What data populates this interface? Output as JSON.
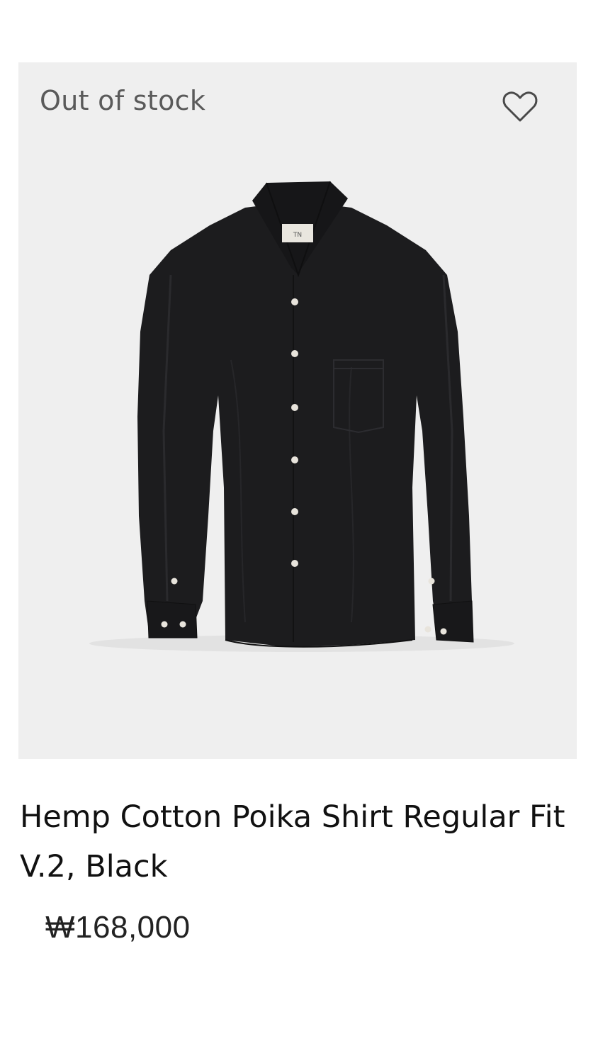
{
  "product": {
    "stock_status": "Out of stock",
    "title": "Hemp Cotton Poika Shirt Regular Fit V.2, Black",
    "price": "₩168,000",
    "label_text": "TN",
    "wishlist_icon": "heart-outline-icon",
    "colors": {
      "image_background": "#efefef",
      "shirt": "#1c1c1e",
      "button": "#e8e4dc",
      "text": "#111111",
      "muted_text": "#5a5a5a"
    }
  }
}
